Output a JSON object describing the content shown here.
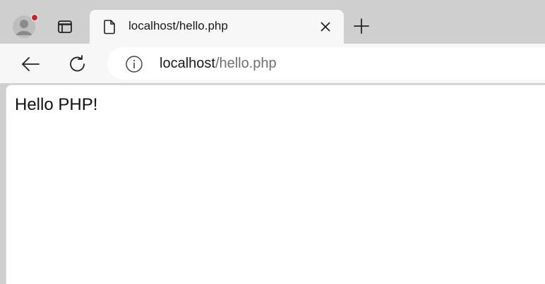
{
  "tab": {
    "title": "localhost/hello.php",
    "favicon_icon": "page-icon"
  },
  "toolbar": {
    "address": {
      "host": "localhost",
      "path": "/hello.php"
    }
  },
  "page": {
    "body_text": "Hello PHP!"
  },
  "icons": {
    "profile": "profile-avatar-icon",
    "workspaces": "tab-actions-icon",
    "close": "close-icon",
    "new_tab": "plus-icon",
    "back": "back-arrow-icon",
    "refresh": "refresh-icon",
    "site_info": "info-icon"
  },
  "colors": {
    "notification_dot": "#d42020",
    "url_path": "#6f6f6f"
  }
}
